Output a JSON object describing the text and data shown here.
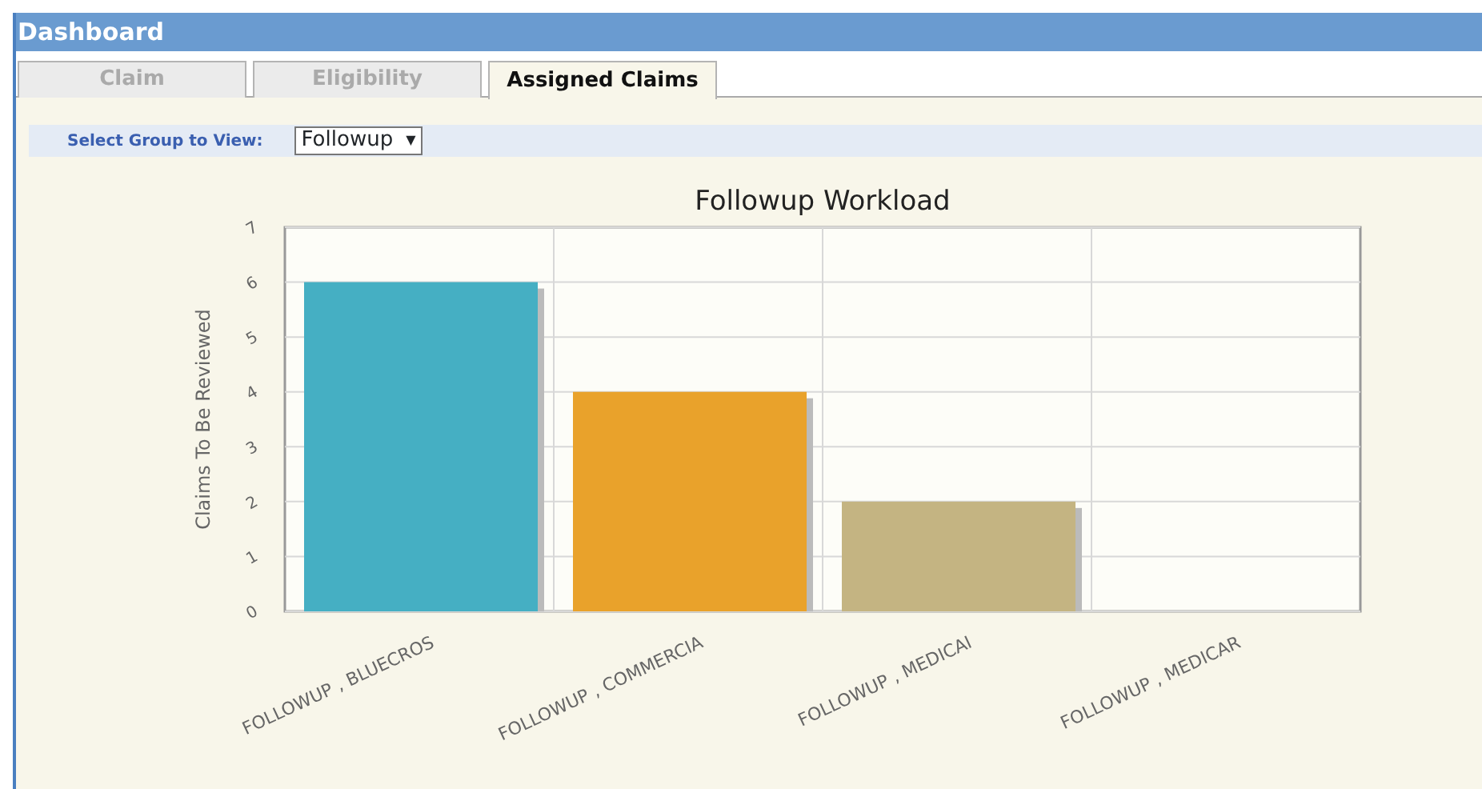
{
  "window": {
    "title": "Dashboard"
  },
  "tabs": [
    {
      "label": "Claim",
      "selected": false
    },
    {
      "label": "Eligibility",
      "selected": false
    },
    {
      "label": "Assigned Claims",
      "selected": true
    }
  ],
  "filter": {
    "label": "Select Group to View:",
    "value": "Followup",
    "caret": "▼"
  },
  "chart_data": {
    "type": "bar",
    "title": "Followup Workload",
    "ylabel": "Claims To Be Reviewed",
    "categories": [
      "FOLLOWUP , BLUECROS",
      "FOLLOWUP , COMMERCIA",
      "FOLLOWUP , MEDICAI",
      "FOLLOWUP , MEDICAR"
    ],
    "series": [
      {
        "color": "#45afc3",
        "values": [
          6,
          null,
          null,
          null
        ]
      },
      {
        "color": "#e9a22b",
        "values": [
          null,
          4,
          null,
          null
        ]
      },
      {
        "color": "#c4b482",
        "values": [
          null,
          null,
          2,
          null
        ]
      },
      {
        "values": [
          null,
          null,
          null,
          0
        ]
      }
    ],
    "stacked": true,
    "grid": true,
    "ylim": [
      0,
      7
    ],
    "yticks": [
      0,
      1,
      2,
      3,
      4,
      5,
      6,
      7
    ]
  }
}
